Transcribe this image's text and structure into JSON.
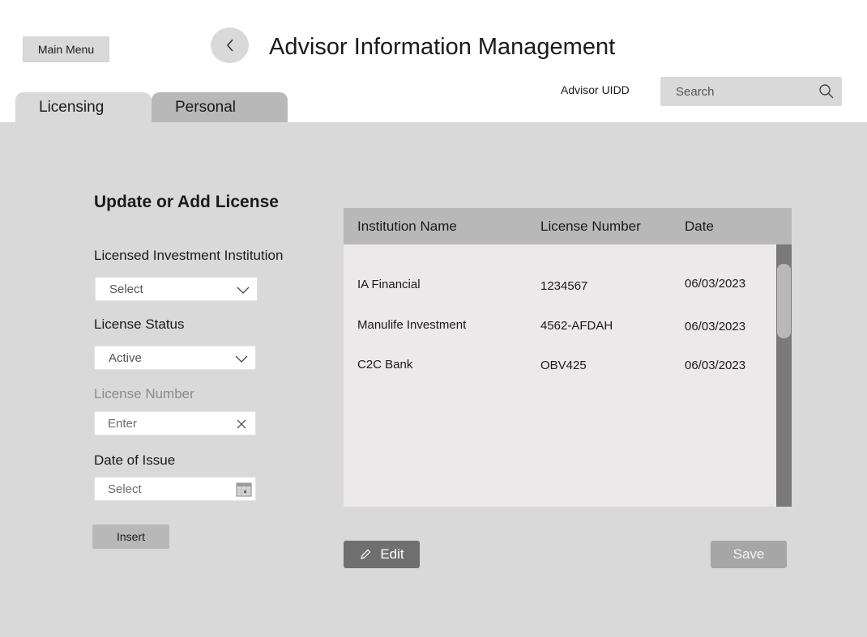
{
  "header": {
    "main_menu_label": "Main Menu",
    "title": "Advisor Information Management",
    "uidd_label": "Advisor UIDD",
    "search_placeholder": "Search"
  },
  "tabs": [
    {
      "label": "Licensing",
      "active": true
    },
    {
      "label": "Personal",
      "active": false
    }
  ],
  "form": {
    "title": "Update or Add License",
    "institution": {
      "label": "Licensed Investment Institution",
      "value": "Select"
    },
    "status": {
      "label": "License Status",
      "value": "Active"
    },
    "license_number": {
      "label": "License Number",
      "placeholder": "Enter"
    },
    "date_of_issue": {
      "label": "Date of Issue",
      "placeholder": "Select"
    },
    "insert_label": "Insert"
  },
  "table": {
    "columns": [
      "Institution Name",
      "License Number",
      "Date"
    ],
    "rows": [
      {
        "institution": "IA Financial",
        "license": "1234567",
        "date": "06/03/2023"
      },
      {
        "institution": "Manulife Investment",
        "license": "4562-AFDAH",
        "date": "06/03/2023"
      },
      {
        "institution": "C2C Bank",
        "license": "OBV425",
        "date": "06/03/2023"
      }
    ]
  },
  "actions": {
    "edit_label": "Edit",
    "save_label": "Save"
  },
  "icons": {
    "back": "chevron-left-icon",
    "search": "search-icon",
    "dropdown": "chevron-down-icon",
    "clear": "close-icon",
    "calendar": "calendar-icon",
    "edit": "pencil-icon"
  }
}
